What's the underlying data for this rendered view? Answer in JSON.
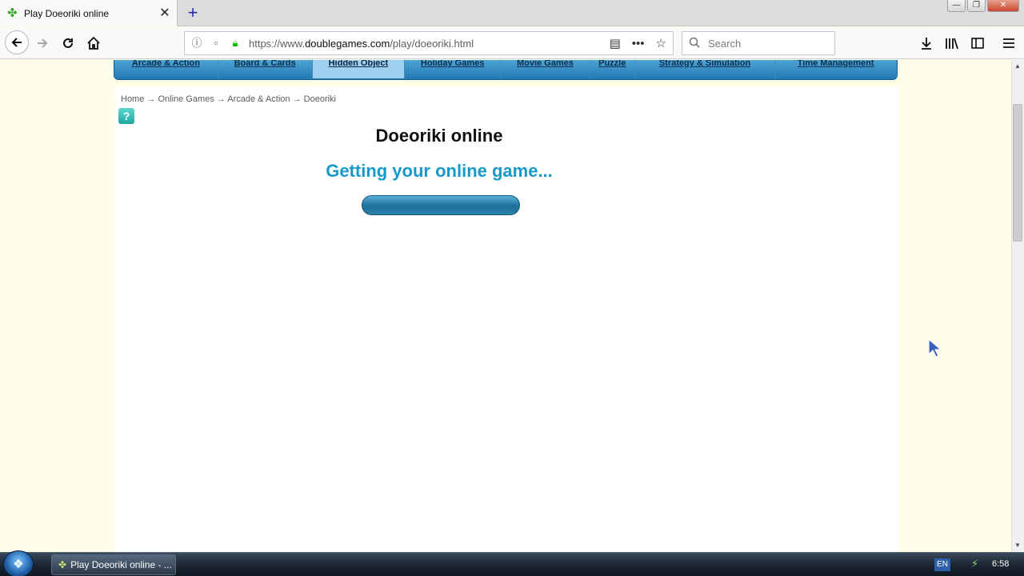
{
  "browser": {
    "tab": {
      "title": "Play Doeoriki online",
      "close": "✕",
      "favicon": "clover-icon"
    },
    "new_tab": "+",
    "window_controls": {
      "minimize": "—",
      "restore": "❐",
      "close": "✕"
    },
    "url": {
      "prefix": "https://www.",
      "host": "doublegames.com",
      "path": "/play/doeoriki.html"
    },
    "search_placeholder": "Search"
  },
  "site": {
    "categories": [
      {
        "label": "Arcade & Action",
        "active": false
      },
      {
        "label": "Board & Cards",
        "active": false
      },
      {
        "label": "Hidden Object",
        "active": true
      },
      {
        "label": "Holiday Games",
        "active": false
      },
      {
        "label": "Movie Games",
        "active": false
      },
      {
        "label": "Puzzle",
        "active": false
      },
      {
        "label": "Strategy & Simulation",
        "active": false
      },
      {
        "label": "Time Management",
        "active": false
      }
    ],
    "breadcrumb": "Home → Online Games → Arcade & Action → Doeoriki",
    "help": "?",
    "game_title": "Doeoriki online",
    "loading_text": "Getting your online game...",
    "progress": 0
  },
  "taskbar": {
    "item": "Play Doeoriki online - ...",
    "lang": "EN",
    "time": "6:58"
  },
  "colors": {
    "page_bg": "#fdfde8",
    "nav_blue": "#1f78b5",
    "loading_text": "#1899c9"
  }
}
